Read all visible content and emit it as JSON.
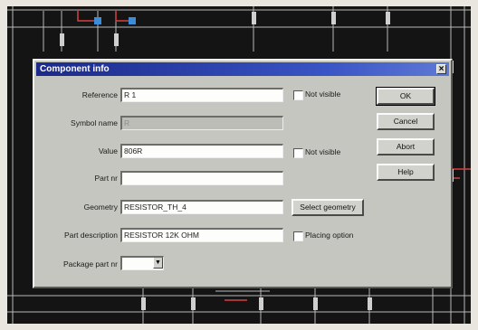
{
  "colors": {
    "titlebar": "#1b2a8a",
    "schematic_bg": "#141414",
    "dialog_bg": "#c6c6c1"
  },
  "dialog": {
    "title": "Component info",
    "close_icon": "×",
    "fields": {
      "reference": {
        "label": "Reference",
        "value": "R 1"
      },
      "symbol_name": {
        "label": "Symbol name",
        "value": "R"
      },
      "value": {
        "label": "Value",
        "value": "806R"
      },
      "part_nr": {
        "label": "Part nr",
        "value": ""
      },
      "geometry": {
        "label": "Geometry",
        "value": "RESISTOR_TH_4"
      },
      "part_description": {
        "label": "Part description",
        "value": "RESISTOR 12K OHM"
      },
      "package_part_nr": {
        "label": "Package part nr",
        "value": ""
      }
    },
    "checkboxes": {
      "reference_not_visible": "Not visible",
      "value_not_visible": "Not visible",
      "placing_option": "Placing option"
    },
    "buttons": {
      "ok": "OK",
      "cancel": "Cancel",
      "abort": "Abort",
      "help": "Help",
      "select_geometry": "Select geometry"
    },
    "dropdown_arrow_icon": "▼"
  }
}
